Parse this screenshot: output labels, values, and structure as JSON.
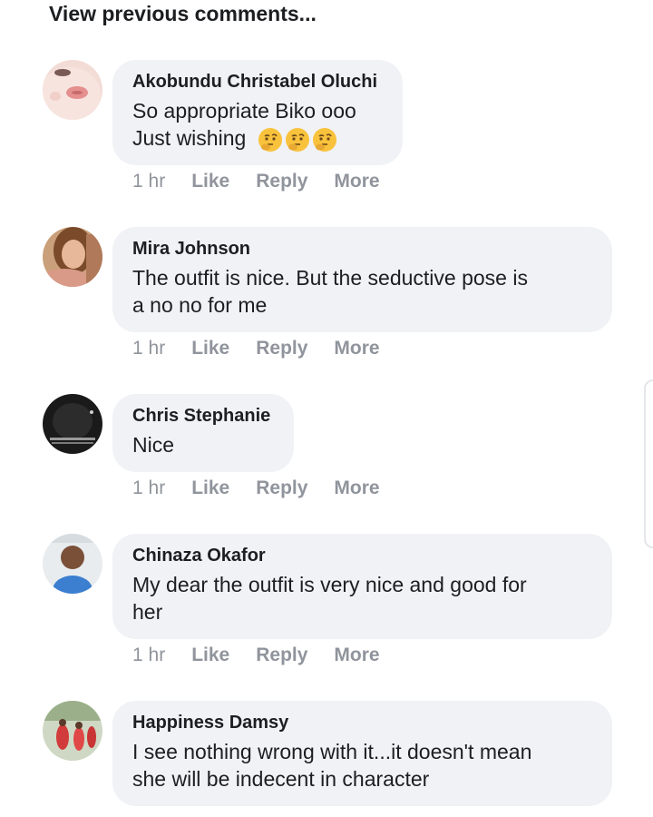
{
  "view_previous_label": "View previous comments...",
  "comments": [
    {
      "author": "Akobundu Christabel Oluchi",
      "line1": "So appropriate Biko ooo",
      "line2": "Just wishing",
      "emoji": "thinking-face-icon",
      "time": "1 hr",
      "like": "Like",
      "reply": "Reply",
      "more": "More"
    },
    {
      "author": "Mira Johnson",
      "line1": "The outfit is nice. But the seductive pose is",
      "line2": "a no no for me",
      "time": "1 hr",
      "like": "Like",
      "reply": "Reply",
      "more": "More"
    },
    {
      "author": "Chris Stephanie",
      "line1": "Nice",
      "time": "1 hr",
      "like": "Like",
      "reply": "Reply",
      "more": "More"
    },
    {
      "author": "Chinaza Okafor",
      "line1": "My dear the outfit is very nice and good for",
      "line2": "her",
      "time": "1 hr",
      "like": "Like",
      "reply": "Reply",
      "more": "More"
    },
    {
      "author": "Happiness Damsy",
      "line1": "I see nothing wrong with it...it doesn't mean",
      "line2": "she will be indecent in character"
    }
  ],
  "colors": {
    "bubble": "#f0f2f5",
    "meta": "#90949c",
    "text": "#1c1e21"
  }
}
